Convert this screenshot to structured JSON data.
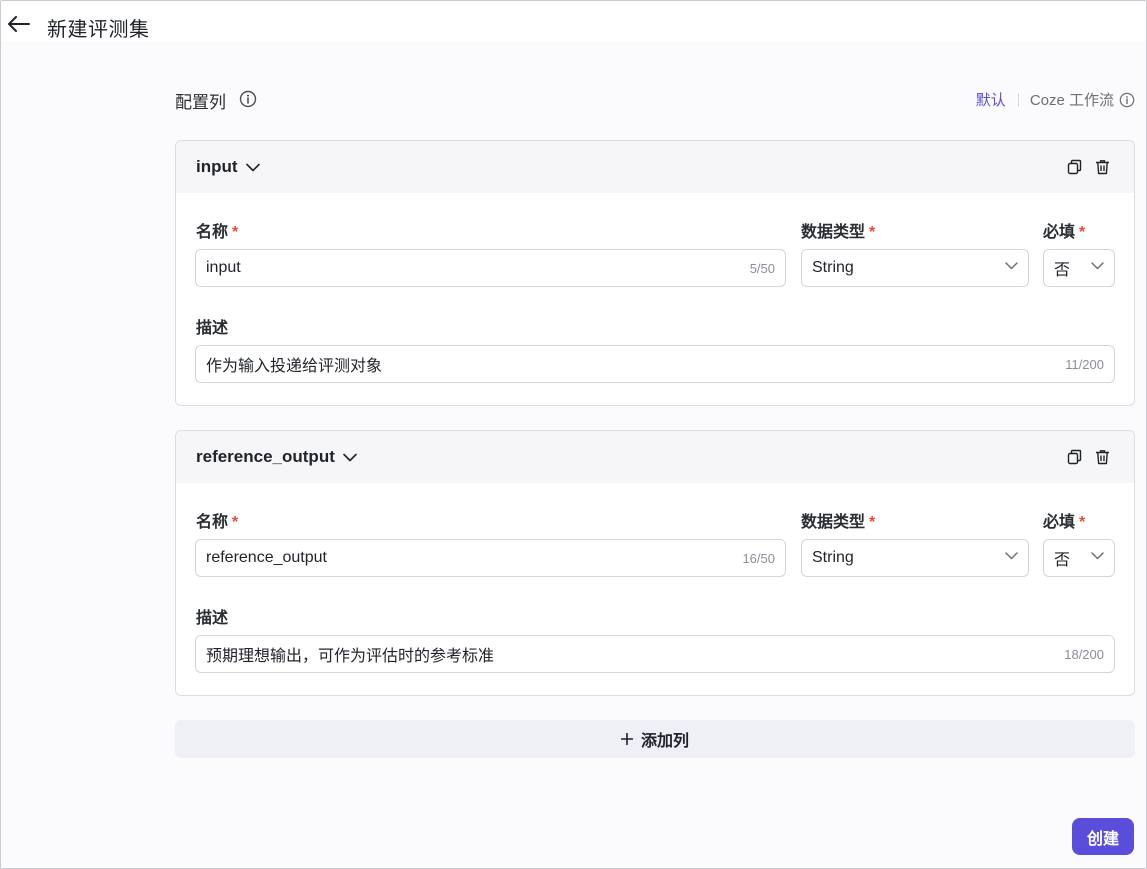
{
  "page": {
    "title": "新建评测集"
  },
  "section": {
    "title": "配置列",
    "mode_default": "默认",
    "mode_coze": "Coze 工作流"
  },
  "labels": {
    "name": "名称",
    "data_type": "数据类型",
    "required": "必填",
    "description": "描述",
    "required_mark": "*"
  },
  "columns": [
    {
      "header": "input",
      "name_value": "input",
      "name_counter": "5/50",
      "data_type": "String",
      "required": "否",
      "description": "作为输入投递给评测对象",
      "description_counter": "11/200"
    },
    {
      "header": "reference_output",
      "name_value": "reference_output",
      "name_counter": "16/50",
      "data_type": "String",
      "required": "否",
      "description": "预期理想输出，可作为评估时的参考标准",
      "description_counter": "18/200"
    }
  ],
  "actions": {
    "add_column": "添加列",
    "create": "创建"
  },
  "colors": {
    "accent": "#5b4ddb",
    "required": "#e5493a"
  },
  "icons": [
    "arrow-left-icon",
    "info-icon",
    "chevron-down-icon",
    "copy-icon",
    "trash-icon",
    "plus-icon"
  ]
}
